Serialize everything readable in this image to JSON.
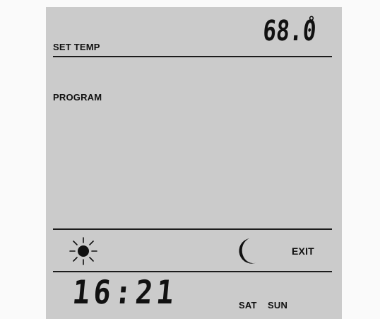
{
  "header": {
    "set_temp_label": "SET TEMP",
    "temperature": "68.0",
    "degree_symbol": "°"
  },
  "program": {
    "label": "PROGRAM"
  },
  "controls": {
    "sun_icon": "sun-icon",
    "moon_icon": "moon-icon",
    "exit_label": "EXIT"
  },
  "footer": {
    "time": "16:21",
    "days": [
      "SAT",
      "SUN"
    ]
  },
  "colors": {
    "screen_bg": "#cbcbcb",
    "ink": "#111111",
    "page_bg": "#fafafa"
  }
}
